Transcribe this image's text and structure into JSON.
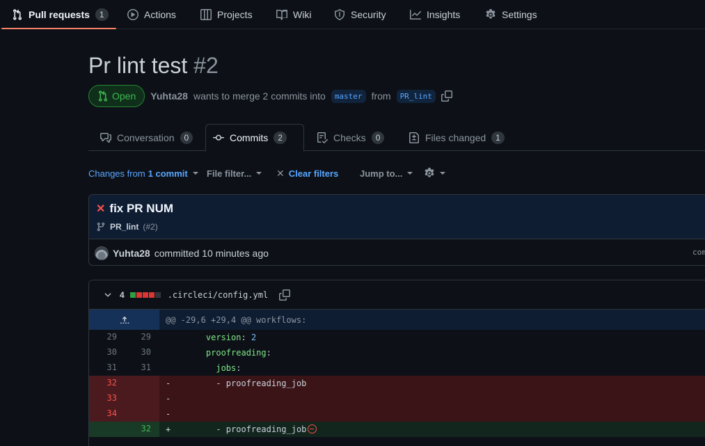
{
  "repo_nav": {
    "items": [
      {
        "label": "Pull requests",
        "count": "1"
      },
      {
        "label": "Actions"
      },
      {
        "label": "Projects"
      },
      {
        "label": "Wiki"
      },
      {
        "label": "Security"
      },
      {
        "label": "Insights"
      },
      {
        "label": "Settings"
      }
    ]
  },
  "pr": {
    "title": "Pr lint test",
    "number": "#2",
    "state": "Open",
    "author": "Yuhta28",
    "merge_text": "wants to merge 2 commits into",
    "base_branch": "master",
    "from_text": "from",
    "head_branch": "PR_lint"
  },
  "tabs": [
    {
      "label": "Conversation",
      "count": "0",
      "icon": "comment-icon"
    },
    {
      "label": "Commits",
      "count": "2",
      "icon": "commit-icon"
    },
    {
      "label": "Checks",
      "count": "0",
      "icon": "checklist-icon"
    },
    {
      "label": "Files changed",
      "count": "1",
      "icon": "file-diff-icon"
    }
  ],
  "toolbar": {
    "changes_prefix": "Changes from",
    "changes_link": "1 commit",
    "file_filter": "File filter...",
    "clear_filters": "Clear filters",
    "jump_to": "Jump to..."
  },
  "commit": {
    "title": "fix PR NUM",
    "status": "failed",
    "branch": "PR_lint",
    "pr_ref": "(#2)",
    "author": "Yuhta28",
    "meta": "committed 10 minutes ago",
    "sha_fragment": "com"
  },
  "diff": {
    "change_count": "4",
    "diffstat": [
      "added",
      "deleted",
      "deleted",
      "deleted",
      "neutral"
    ],
    "filename": ".circleci/config.yml",
    "hunk_header": "@@ -29,6 +29,4 @@ workflows:",
    "lines": [
      {
        "old": "29",
        "new": "29",
        "sign": "",
        "key": "version",
        "value": "2",
        "indent": "    "
      },
      {
        "old": "30",
        "new": "30",
        "sign": "",
        "key": "proofreading",
        "value": "",
        "indent": "    "
      },
      {
        "old": "31",
        "new": "31",
        "sign": "",
        "key": "jobs",
        "value": "",
        "indent": "      "
      },
      {
        "old": "32",
        "new": "",
        "sign": "-",
        "text": "      - proofreading_job"
      },
      {
        "old": "33",
        "new": "",
        "sign": "-",
        "text": ""
      },
      {
        "old": "34",
        "new": "",
        "sign": "-",
        "text": ""
      },
      {
        "old": "",
        "new": "32",
        "sign": "+",
        "text": "      - proofreading_job"
      }
    ]
  },
  "colors": {
    "accent_underline": "#f78166",
    "open_green": "#3fb950",
    "link_blue": "#58a6ff",
    "deletion_red": "#f85149"
  }
}
